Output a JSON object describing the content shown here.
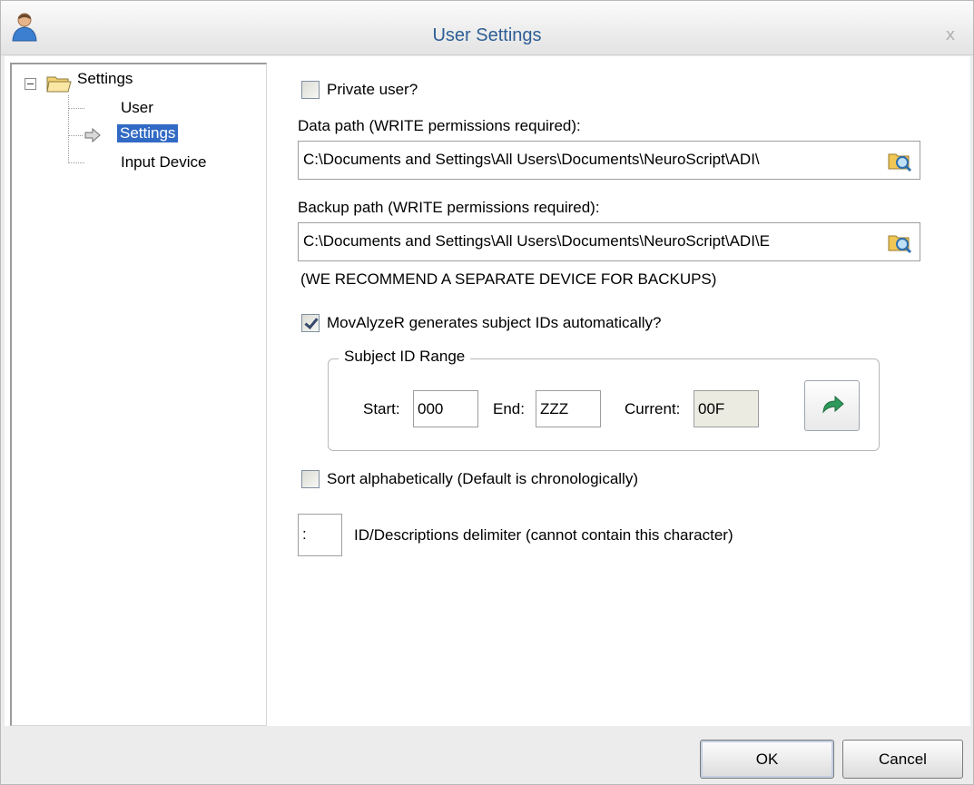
{
  "window": {
    "title": "User Settings",
    "close_glyph": "x"
  },
  "tree": {
    "root_label": "Settings",
    "items": [
      {
        "label": "User",
        "selected": false
      },
      {
        "label": "Settings",
        "selected": true
      },
      {
        "label": "Input Device",
        "selected": false
      }
    ]
  },
  "form": {
    "private_user": {
      "label": "Private user?",
      "checked": false
    },
    "data_path": {
      "label": "Data path (WRITE permissions required):",
      "value": "C:\\Documents and Settings\\All Users\\Documents\\NeuroScript\\ADI\\"
    },
    "backup_path": {
      "label": "Backup path (WRITE permissions required):",
      "value": "C:\\Documents and Settings\\All Users\\Documents\\NeuroScript\\ADI\\E",
      "note": "(WE RECOMMEND A SEPARATE DEVICE FOR BACKUPS)"
    },
    "auto_ids": {
      "label": "MovAlyzeR generates subject IDs automatically?",
      "checked": true
    },
    "subject_range": {
      "legend": "Subject ID Range",
      "start_label": "Start:",
      "start_value": "000",
      "end_label": "End:",
      "end_value": "ZZZ",
      "current_label": "Current:",
      "current_value": "00F"
    },
    "sort_alpha": {
      "label": "Sort alphabetically (Default is chronologically)",
      "checked": false
    },
    "delimiter": {
      "value": ":",
      "label": "ID/Descriptions delimiter (cannot contain this character)"
    }
  },
  "buttons": {
    "ok": "OK",
    "cancel": "Cancel"
  },
  "icons": {
    "title": "user-icon",
    "folder": "folder-icon",
    "arrow": "arrow-right-icon",
    "browse": "browse-folder-icon",
    "refresh": "refresh-icon"
  },
  "colors": {
    "title_text": "#2e5e94",
    "selection": "#316ac5"
  }
}
